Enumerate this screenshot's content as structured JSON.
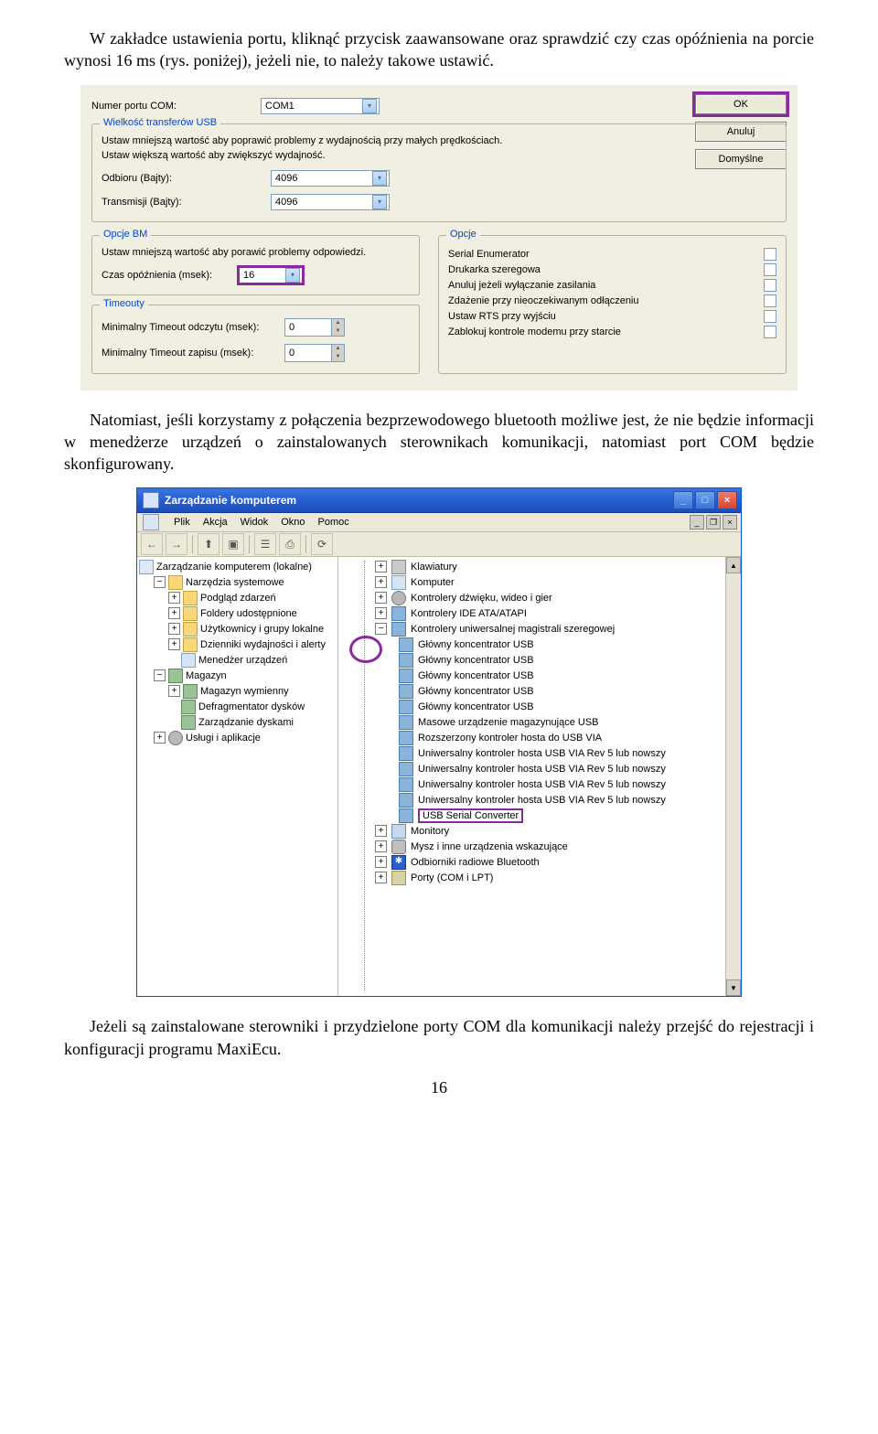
{
  "para1": "W zakładce ustawienia portu, kliknąć przycisk zaawansowane oraz sprawdzić czy czas opóźnienia na porcie wynosi 16 ms (rys. poniżej), jeżeli nie, to należy takowe ustawić.",
  "para2": "Natomiast, jeśli korzystamy z połączenia bezprzewodowego bluetooth możliwe jest, że nie będzie informacji w menedżerze urządzeń o zainstalowanych sterownikach komunikacji, natomiast port COM będzie skonfigurowany.",
  "para3": "Jeżeli są zainstalowane sterowniki i przydzielone porty COM dla komunikacji należy przejść do rejestracji i konfiguracji programu MaxiEcu.",
  "pagenum": "16",
  "dlg": {
    "port_label": "Numer portu COM:",
    "port_value": "COM1",
    "ok": "OK",
    "cancel": "Anuluj",
    "defaults": "Domyślne",
    "usb_title": "Wielkość transferów USB",
    "usb_desc1": "Ustaw mniejszą wartość aby poprawić problemy z wydajnością przy małych prędkościach.",
    "usb_desc2": "Ustaw większą wartość aby zwiększyć wydajność.",
    "rx_label": "Odbioru (Bajty):",
    "rx_value": "4096",
    "tx_label": "Transmisji (Bajty):",
    "tx_value": "4096",
    "bm_title": "Opcje BM",
    "bm_desc": "Ustaw mniejszą wartość aby porawić problemy odpowiedzi.",
    "lat_label": "Czas opóźnienia (msek):",
    "lat_value": "16",
    "to_title": "Timeouty",
    "to_read_label": "Minimalny Timeout odczytu (msek):",
    "to_read_value": "0",
    "to_write_label": "Minimalny Timeout zapisu (msek):",
    "to_write_value": "0",
    "opts_title": "Opcje",
    "opts": [
      "Serial Enumerator",
      "Drukarka szeregowa",
      "Anuluj jeżeli wyłączanie zasilania",
      "Zdażenie przy nieoczekiwanym odłączeniu",
      "Ustaw RTS przy wyjściu",
      "Zablokuj kontrole modemu przy starcie"
    ]
  },
  "mmc": {
    "title": "Zarządzanie komputerem",
    "menu": [
      "Plik",
      "Akcja",
      "Widok",
      "Okno",
      "Pomoc"
    ],
    "tree": {
      "root": "Zarządzanie komputerem (lokalne)",
      "tools": "Narzędzia systemowe",
      "tools_items": [
        "Podgląd zdarzeń",
        "Foldery udostępnione",
        "Użytkownicy i grupy lokalne",
        "Dzienniki wydajności i alerty",
        "Menedżer urządzeń"
      ],
      "storage": "Magazyn",
      "storage_items": [
        "Magazyn wymienny",
        "Defragmentator dysków",
        "Zarządzanie dyskami"
      ],
      "services": "Usługi i aplikacje"
    },
    "list": [
      {
        "icon": "kbd",
        "label": "Klawiatury",
        "exp": "+"
      },
      {
        "icon": "comp",
        "label": "Komputer",
        "exp": "+"
      },
      {
        "icon": "gear",
        "label": "Kontrolery dźwięku, wideo i gier",
        "exp": "+"
      },
      {
        "icon": "usb",
        "label": "Kontrolery IDE ATA/ATAPI",
        "exp": "+"
      },
      {
        "icon": "usb",
        "label": "Kontrolery uniwersalnej magistrali szeregowej",
        "exp": "-",
        "children": [
          {
            "icon": "usb",
            "label": "Główny koncentrator USB"
          },
          {
            "icon": "usb",
            "label": "Główny koncentrator USB"
          },
          {
            "icon": "usb",
            "label": "Główny koncentrator USB"
          },
          {
            "icon": "usb",
            "label": "Główny koncentrator USB"
          },
          {
            "icon": "usb",
            "label": "Główny koncentrator USB"
          },
          {
            "icon": "usb",
            "label": "Masowe urządzenie magazynujące USB"
          },
          {
            "icon": "usb",
            "label": "Rozszerzony kontroler hosta do USB VIA"
          },
          {
            "icon": "usb",
            "label": "Uniwersalny kontroler hosta USB VIA Rev 5 lub nowszy"
          },
          {
            "icon": "usb",
            "label": "Uniwersalny kontroler hosta USB VIA Rev 5 lub nowszy"
          },
          {
            "icon": "usb",
            "label": "Uniwersalny kontroler hosta USB VIA Rev 5 lub nowszy"
          },
          {
            "icon": "usb",
            "label": "Uniwersalny kontroler hosta USB VIA Rev 5 lub nowszy"
          },
          {
            "icon": "usb",
            "label": "USB Serial Converter",
            "hl": true
          }
        ]
      },
      {
        "icon": "mon",
        "label": "Monitory",
        "exp": "+"
      },
      {
        "icon": "mouse",
        "label": "Mysz i inne urządzenia wskazujące",
        "exp": "+"
      },
      {
        "icon": "bt",
        "label": "Odbiorniki radiowe Bluetooth",
        "exp": "+"
      },
      {
        "icon": "port",
        "label": "Porty (COM i LPT)",
        "exp": "+"
      }
    ]
  }
}
